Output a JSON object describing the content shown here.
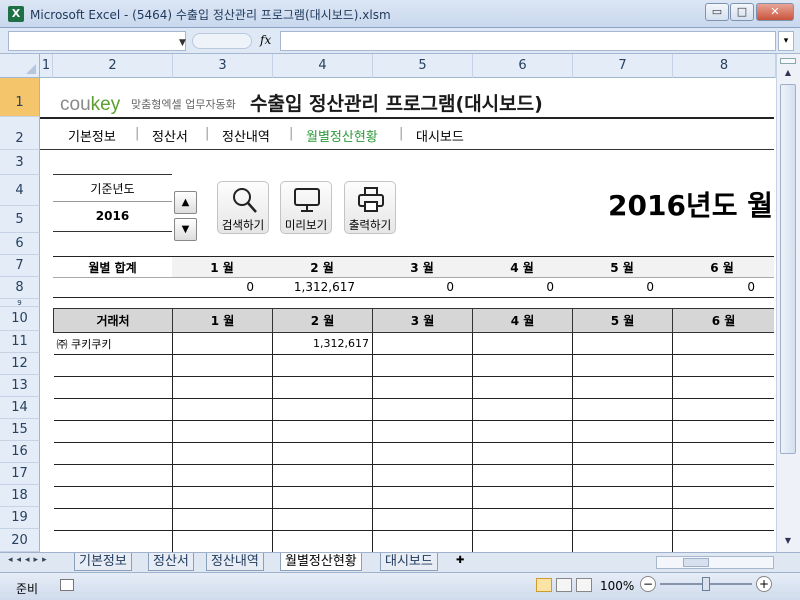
{
  "window": {
    "title": "Microsoft Excel - (5464) 수출입 정산관리 프로그램(대시보드).xlsm",
    "app_icon": "X",
    "min": "▭",
    "max": "□",
    "close": "✕"
  },
  "formula_bar": {
    "fx": "fx",
    "namebox": ""
  },
  "columns": [
    "1",
    "2",
    "3",
    "4",
    "5",
    "6",
    "7",
    "8"
  ],
  "rows": [
    "1",
    "2",
    "3",
    "4",
    "5",
    "6",
    "7",
    "8",
    "9",
    "10",
    "11",
    "12",
    "13",
    "14",
    "15",
    "16",
    "17",
    "18",
    "19",
    "20"
  ],
  "header": {
    "logo_cou": "cou",
    "logo_key": "key",
    "logo_sub": "맞춤형엑셀 업무자동화",
    "program_title": "수출입 정산관리 프로그램(대시보드)"
  },
  "nav": {
    "items": [
      "기본정보",
      "정산서",
      "정산내역",
      "월별정산현황",
      "대시보드"
    ],
    "separator": "|",
    "active_color": "#2e9a3a"
  },
  "controls": {
    "year_label": "기준년도",
    "year_value": "2016",
    "spin_up": "▲",
    "spin_down": "▼",
    "search": "검색하기",
    "preview": "미리보기",
    "print": "출력하기"
  },
  "big_title": "2016년도 월",
  "monthly_sum": {
    "label": "월별 합계",
    "months": [
      "1 월",
      "2 월",
      "3 월",
      "4 월",
      "5 월",
      "6 월"
    ],
    "values": [
      "0",
      "1,312,617",
      "0",
      "0",
      "0",
      "0"
    ]
  },
  "table": {
    "headers": [
      "거래처",
      "1 월",
      "2 월",
      "3 월",
      "4 월",
      "5 월",
      "6 월"
    ],
    "rows": [
      [
        "㈜ 쿠키쿠키",
        "",
        "1,312,617",
        "",
        "",
        "",
        ""
      ],
      [
        "",
        "",
        "",
        "",
        "",
        "",
        ""
      ],
      [
        "",
        "",
        "",
        "",
        "",
        "",
        ""
      ],
      [
        "",
        "",
        "",
        "",
        "",
        "",
        ""
      ],
      [
        "",
        "",
        "",
        "",
        "",
        "",
        ""
      ],
      [
        "",
        "",
        "",
        "",
        "",
        "",
        ""
      ],
      [
        "",
        "",
        "",
        "",
        "",
        "",
        ""
      ],
      [
        "",
        "",
        "",
        "",
        "",
        "",
        ""
      ],
      [
        "",
        "",
        "",
        "",
        "",
        "",
        ""
      ],
      [
        "",
        "",
        "",
        "",
        "",
        "",
        ""
      ]
    ]
  },
  "sheet_tabs": [
    "기본정보",
    "정산서",
    "정산내역",
    "월별정산현황",
    "대시보드"
  ],
  "active_tab": "월별정산현황",
  "status": {
    "ready": "준비",
    "zoom": "100%",
    "zoom_minus": "−",
    "zoom_plus": "+"
  }
}
